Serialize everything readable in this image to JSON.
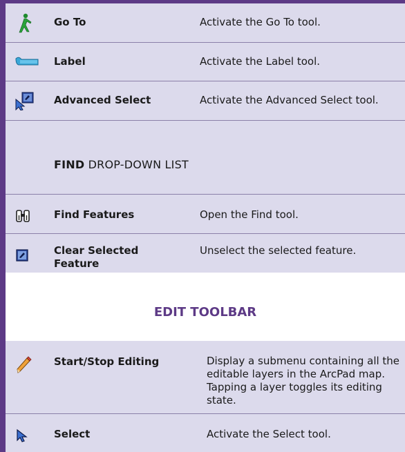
{
  "rows_nav": [
    {
      "icon": "walking-person-icon",
      "name": "Go To",
      "desc": "Activate the Go To tool."
    },
    {
      "icon": "label-tag-icon",
      "name": "Label",
      "desc": "Activate the Label tool."
    },
    {
      "icon": "advanced-select-icon",
      "name": "Advanced Select",
      "desc": "Activate the Advanced Select tool."
    }
  ],
  "find_list": {
    "bold": "FIND",
    "rest": " DROP-DOWN LIST",
    "rows": [
      {
        "icon": "binoculars-icon",
        "name": "Find Features",
        "desc": "Open the Find tool."
      },
      {
        "icon": "clear-select-icon",
        "name": "Clear Selected Feature",
        "desc": "Unselect the selected feature."
      }
    ]
  },
  "edit_toolbar": {
    "title": "EDIT TOOLBAR",
    "rows": [
      {
        "icon": "pencil-icon",
        "name": "Start/Stop Editing",
        "desc": "Display a submenu containing all the editable layers in the ArcPad map. Tapping a layer toggles its editing state."
      },
      {
        "icon": "select-arrow-icon",
        "name": "Select",
        "desc": "Activate the Select tool."
      }
    ]
  },
  "colors": {
    "accent": "#5d3a86",
    "row_bg": "#dcdaec"
  }
}
